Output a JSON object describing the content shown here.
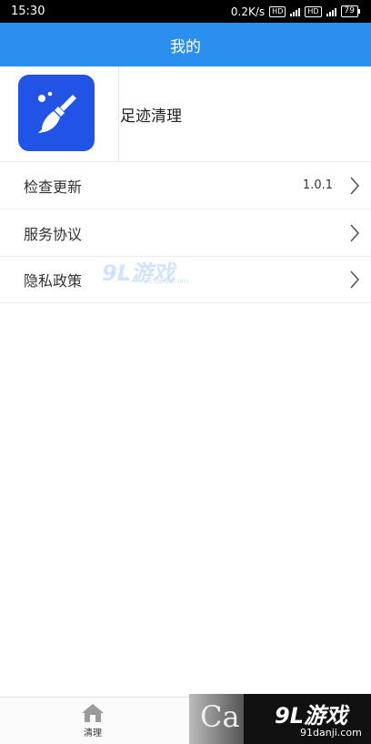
{
  "status_bar": {
    "time": "15:30",
    "net_speed": "0.2K/s",
    "hd1": "HD",
    "net1": "4G",
    "hd2": "HD",
    "net2": "4G",
    "battery": "79"
  },
  "header": {
    "title": "我的"
  },
  "app": {
    "name": "足迹清理",
    "logo_icon": "broom-sparkle-icon",
    "logo_color": "#2154e6"
  },
  "menu": {
    "items": [
      {
        "label": "检查更新",
        "value": "1.0.1"
      },
      {
        "label": "服务协议"
      },
      {
        "label": "隐私政策"
      }
    ]
  },
  "watermark": {
    "center_text": "9L游戏",
    "center_url": "91danji.com",
    "corner_logo": "9L游戏",
    "corner_url": "91danji.com",
    "corner_letter": "Ca"
  },
  "tabbar": {
    "tabs": [
      {
        "label": "清理",
        "icon": "home-icon"
      }
    ]
  },
  "colors": {
    "primary": "#2b8ff0"
  }
}
